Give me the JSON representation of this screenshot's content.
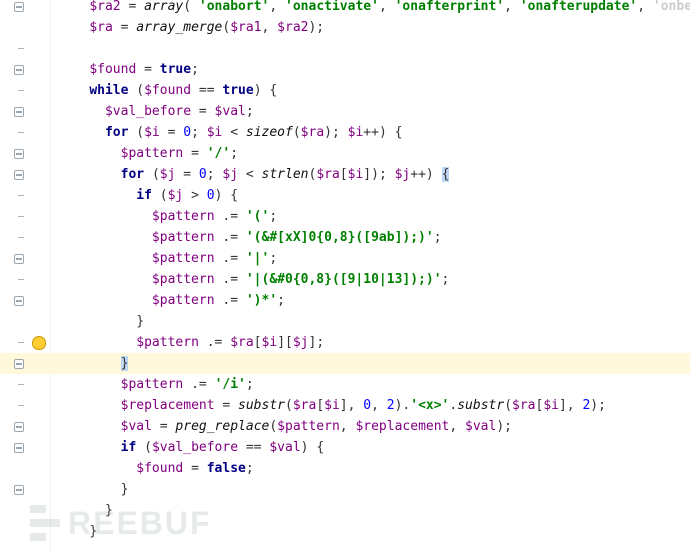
{
  "watermark": "REEBUF",
  "gutter_markers": {
    "bulb_line_index": 16,
    "fold_lines": [
      0,
      3,
      5,
      7,
      8,
      12,
      14,
      17,
      20,
      21,
      23
    ],
    "tick_lines": [
      2,
      4,
      6,
      9,
      10,
      11,
      13,
      16,
      18,
      19
    ]
  },
  "lines": [
    {
      "indent": 2,
      "html": "<span class='tok-var'>$ra2</span> <span class='tok-assign'>=</span> <span class='tok-fn'>array</span><span class='tok-op'>(</span> <span class='tok-str'>'onabort'</span><span class='tok-op'>,</span> <span class='tok-str'>'onactivate'</span><span class='tok-op'>,</span> <span class='tok-str'>'onafterprint'</span><span class='tok-op'>,</span> <span class='tok-str'>'onafterupdate'</span><span class='tok-op'>,</span> <span class='tok-str cutoff'>'onbeforeac</span>"
    },
    {
      "indent": 2,
      "html": "<span class='tok-var'>$ra</span> <span class='tok-assign'>=</span> <span class='tok-fn'>array_merge</span><span class='tok-op'>(</span><span class='tok-var'>$ra1</span><span class='tok-op'>,</span> <span class='tok-var'>$ra2</span><span class='tok-op'>);</span>"
    },
    {
      "indent": 0,
      "html": ""
    },
    {
      "indent": 2,
      "html": "<span class='tok-var'>$found</span> <span class='tok-assign'>=</span> <span class='tok-bool'>true</span><span class='tok-op'>;</span>"
    },
    {
      "indent": 2,
      "html": "<span class='tok-kw'>while</span> <span class='tok-op'>(</span><span class='tok-var'>$found</span> <span class='tok-op'>==</span> <span class='tok-bool'>true</span><span class='tok-op'>)</span> <span class='tok-op'>{</span>"
    },
    {
      "indent": 3,
      "html": "<span class='tok-var'>$val_before</span> <span class='tok-assign'>=</span> <span class='tok-var'>$val</span><span class='tok-op'>;</span>"
    },
    {
      "indent": 3,
      "html": "<span class='tok-kw'>for</span> <span class='tok-op'>(</span><span class='tok-var'>$i</span> <span class='tok-assign'>=</span> <span class='tok-num'>0</span><span class='tok-op'>;</span> <span class='tok-var'>$i</span> <span class='tok-op'>&lt;</span> <span class='tok-fn'>sizeof</span><span class='tok-op'>(</span><span class='tok-var'>$ra</span><span class='tok-op'>);</span> <span class='tok-var'>$i</span><span class='tok-op'>++)</span> <span class='tok-op'>{</span>"
    },
    {
      "indent": 4,
      "html": "<span class='tok-var'>$pattern</span> <span class='tok-assign'>=</span> <span class='tok-str'>'/'</span><span class='tok-op'>;</span>"
    },
    {
      "indent": 4,
      "html": "<span class='tok-kw'>for</span> <span class='tok-op'>(</span><span class='tok-var'>$j</span> <span class='tok-assign'>=</span> <span class='tok-num'>0</span><span class='tok-op'>;</span> <span class='tok-var'>$j</span> <span class='tok-op'>&lt;</span> <span class='tok-fn'>strlen</span><span class='tok-op'>(</span><span class='tok-var'>$ra</span><span class='tok-op'>[</span><span class='tok-var'>$i</span><span class='tok-op'>]);</span> <span class='tok-var'>$j</span><span class='tok-op'>++)</span> <span class='tok-op tok-sel'>{</span>"
    },
    {
      "indent": 5,
      "html": "<span class='tok-kw'>if</span> <span class='tok-op'>(</span><span class='tok-var'>$j</span> <span class='tok-op'>&gt;</span> <span class='tok-num'>0</span><span class='tok-op'>)</span> <span class='tok-op'>{</span>"
    },
    {
      "indent": 6,
      "html": "<span class='tok-var'>$pattern</span> <span class='tok-op'>.=</span> <span class='tok-str'>'('</span><span class='tok-op'>;</span>"
    },
    {
      "indent": 6,
      "html": "<span class='tok-var'>$pattern</span> <span class='tok-op'>.=</span> <span class='tok-str'>'(&amp;#[xX]0{0,8}([9ab]);)'</span><span class='tok-op'>;</span>"
    },
    {
      "indent": 6,
      "html": "<span class='tok-var'>$pattern</span> <span class='tok-op'>.=</span> <span class='tok-str'>'|'</span><span class='tok-op'>;</span>"
    },
    {
      "indent": 6,
      "html": "<span class='tok-var'>$pattern</span> <span class='tok-op'>.=</span> <span class='tok-str'>'|(&amp;#0{0,8}([9|10|13]);)'</span><span class='tok-op'>;</span>"
    },
    {
      "indent": 6,
      "html": "<span class='tok-var'>$pattern</span> <span class='tok-op'>.=</span> <span class='tok-str'>')*'</span><span class='tok-op'>;</span>"
    },
    {
      "indent": 5,
      "html": "<span class='tok-op'>}</span>"
    },
    {
      "indent": 5,
      "html": "<span class='tok-var'>$pattern</span> <span class='tok-op'>.=</span> <span class='tok-var'>$ra</span><span class='tok-op'>[</span><span class='tok-var'>$i</span><span class='tok-op'>][</span><span class='tok-var'>$j</span><span class='tok-op'>];</span>"
    },
    {
      "indent": 4,
      "html": "<span class='tok-op tok-sel'>}</span>",
      "highlight": true
    },
    {
      "indent": 4,
      "html": "<span class='tok-var'>$pattern</span> <span class='tok-op'>.=</span> <span class='tok-str'>'/i'</span><span class='tok-op'>;</span>"
    },
    {
      "indent": 4,
      "html": "<span class='tok-var'>$replacement</span> <span class='tok-assign'>=</span> <span class='tok-fn'>substr</span><span class='tok-op'>(</span><span class='tok-var'>$ra</span><span class='tok-op'>[</span><span class='tok-var'>$i</span><span class='tok-op'>],</span> <span class='tok-num'>0</span><span class='tok-op'>,</span> <span class='tok-num'>2</span><span class='tok-op'>).</span><span class='tok-str'>'&lt;x&gt;'</span><span class='tok-op'>.</span><span class='tok-fn'>substr</span><span class='tok-op'>(</span><span class='tok-var'>$ra</span><span class='tok-op'>[</span><span class='tok-var'>$i</span><span class='tok-op'>],</span> <span class='tok-num'>2</span><span class='tok-op'>);</span>"
    },
    {
      "indent": 4,
      "html": "<span class='tok-var'>$val</span> <span class='tok-assign'>=</span> <span class='tok-fn'>preg_replace</span><span class='tok-op'>(</span><span class='tok-var'>$pattern</span><span class='tok-op'>,</span> <span class='tok-var'>$replacement</span><span class='tok-op'>,</span> <span class='tok-var'>$val</span><span class='tok-op'>);</span>"
    },
    {
      "indent": 4,
      "html": "<span class='tok-kw'>if</span> <span class='tok-op'>(</span><span class='tok-var'>$val_before</span> <span class='tok-op'>==</span> <span class='tok-var'>$val</span><span class='tok-op'>)</span> <span class='tok-op'>{</span>"
    },
    {
      "indent": 5,
      "html": "<span class='tok-var'>$found</span> <span class='tok-assign'>=</span> <span class='tok-bool'>false</span><span class='tok-op'>;</span>"
    },
    {
      "indent": 4,
      "html": "<span class='tok-op'>}</span>"
    },
    {
      "indent": 3,
      "html": "<span class='tok-op'>}</span>"
    },
    {
      "indent": 2,
      "html": "<span class='tok-op'>}</span>"
    }
  ]
}
